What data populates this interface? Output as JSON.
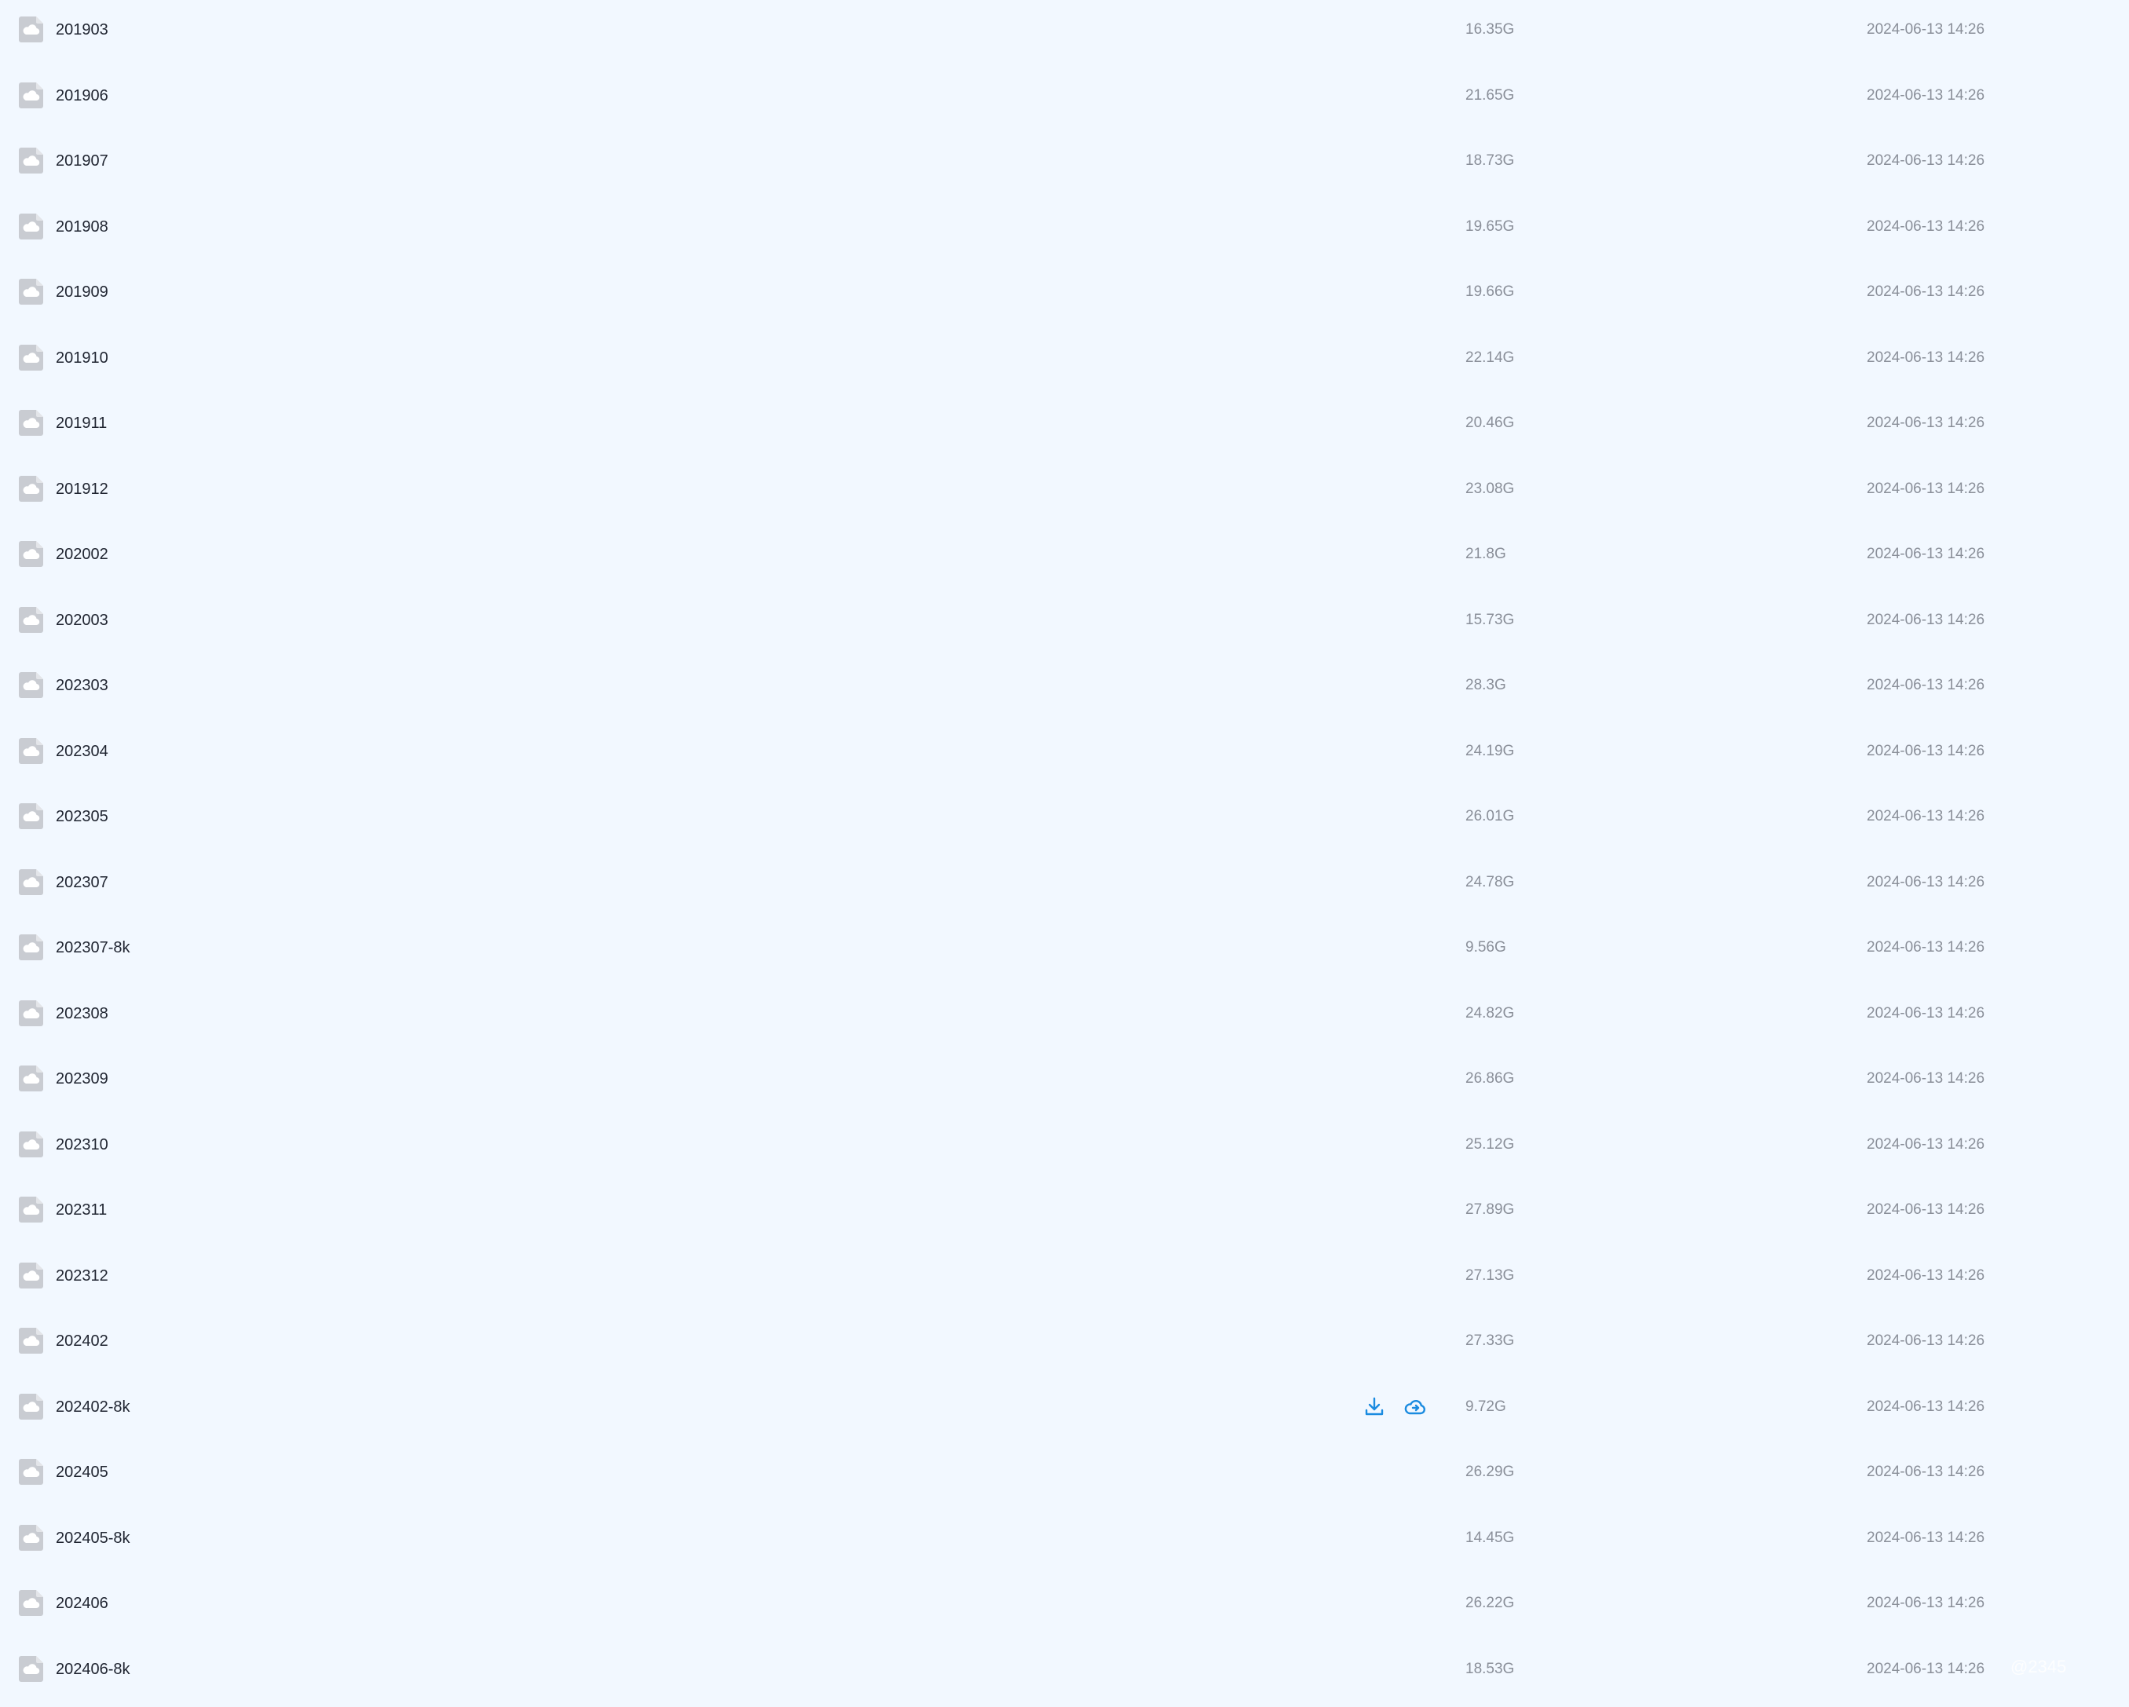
{
  "file_list": {
    "rows": [
      {
        "name": "201903",
        "size": "16.35G",
        "modified": "2024-06-13 14:26",
        "icon": "cloud-file-icon"
      },
      {
        "name": "201906",
        "size": "21.65G",
        "modified": "2024-06-13 14:26",
        "icon": "cloud-file-icon"
      },
      {
        "name": "201907",
        "size": "18.73G",
        "modified": "2024-06-13 14:26",
        "icon": "cloud-file-icon"
      },
      {
        "name": "201908",
        "size": "19.65G",
        "modified": "2024-06-13 14:26",
        "icon": "cloud-file-icon"
      },
      {
        "name": "201909",
        "size": "19.66G",
        "modified": "2024-06-13 14:26",
        "icon": "cloud-file-icon"
      },
      {
        "name": "201910",
        "size": "22.14G",
        "modified": "2024-06-13 14:26",
        "icon": "cloud-file-icon"
      },
      {
        "name": "201911",
        "size": "20.46G",
        "modified": "2024-06-13 14:26",
        "icon": "cloud-file-icon"
      },
      {
        "name": "201912",
        "size": "23.08G",
        "modified": "2024-06-13 14:26",
        "icon": "cloud-file-icon"
      },
      {
        "name": "202002",
        "size": "21.8G",
        "modified": "2024-06-13 14:26",
        "icon": "cloud-file-icon"
      },
      {
        "name": "202003",
        "size": "15.73G",
        "modified": "2024-06-13 14:26",
        "icon": "cloud-file-icon"
      },
      {
        "name": "202303",
        "size": "28.3G",
        "modified": "2024-06-13 14:26",
        "icon": "cloud-file-icon"
      },
      {
        "name": "202304",
        "size": "24.19G",
        "modified": "2024-06-13 14:26",
        "icon": "cloud-file-icon"
      },
      {
        "name": "202305",
        "size": "26.01G",
        "modified": "2024-06-13 14:26",
        "icon": "cloud-file-icon"
      },
      {
        "name": "202307",
        "size": "24.78G",
        "modified": "2024-06-13 14:26",
        "icon": "cloud-file-icon"
      },
      {
        "name": "202307-8k",
        "size": "9.56G",
        "modified": "2024-06-13 14:26",
        "icon": "cloud-file-icon"
      },
      {
        "name": "202308",
        "size": "24.82G",
        "modified": "2024-06-13 14:26",
        "icon": "cloud-file-icon"
      },
      {
        "name": "202309",
        "size": "26.86G",
        "modified": "2024-06-13 14:26",
        "icon": "cloud-file-icon"
      },
      {
        "name": "202310",
        "size": "25.12G",
        "modified": "2024-06-13 14:26",
        "icon": "cloud-file-icon"
      },
      {
        "name": "202311",
        "size": "27.89G",
        "modified": "2024-06-13 14:26",
        "icon": "cloud-file-icon"
      },
      {
        "name": "202312",
        "size": "27.13G",
        "modified": "2024-06-13 14:26",
        "icon": "cloud-file-icon"
      },
      {
        "name": "202402",
        "size": "27.33G",
        "modified": "2024-06-13 14:26",
        "icon": "cloud-file-icon"
      },
      {
        "name": "202402-8k",
        "size": "9.72G",
        "modified": "2024-06-13 14:26",
        "icon": "cloud-file-icon",
        "hovered": true,
        "actions": [
          "download-icon",
          "save-to-cloud-icon"
        ]
      },
      {
        "name": "202405",
        "size": "26.29G",
        "modified": "2024-06-13 14:26",
        "icon": "cloud-file-icon"
      },
      {
        "name": "202405-8k",
        "size": "14.45G",
        "modified": "2024-06-13 14:26",
        "icon": "cloud-file-icon"
      },
      {
        "name": "202406",
        "size": "26.22G",
        "modified": "2024-06-13 14:26",
        "icon": "cloud-file-icon"
      },
      {
        "name": "202406-8k",
        "size": "18.53G",
        "modified": "2024-06-13 14:26",
        "icon": "cloud-file-icon"
      }
    ]
  },
  "colors": {
    "background": "#f2f8ff",
    "name_text": "#1f2430",
    "meta_text": "#8a8f99",
    "icon_gray": "#c9ccd2",
    "action_blue": "#1a8be0"
  },
  "watermark": "@2345"
}
